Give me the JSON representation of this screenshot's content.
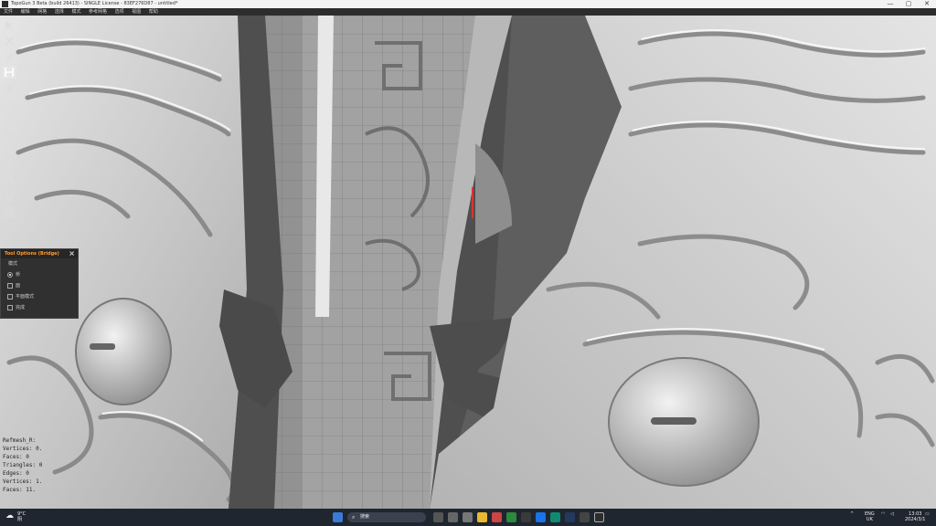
{
  "window": {
    "title": "TopoGun 3 Beta (build 26413) - SINGLE License - 83EF276D87 - untitled*",
    "minimize": "—",
    "maximize": "▢",
    "close": "✕"
  },
  "menu": [
    "文件",
    "编辑",
    "网格",
    "选择",
    "模式",
    "参考网格",
    "选项",
    "视图",
    "帮助"
  ],
  "toolbar": [
    {
      "icon": "select-icon",
      "active": false
    },
    {
      "icon": "erase-icon",
      "active": false
    },
    {
      "icon": "draw-icon",
      "active": false
    },
    {
      "icon": "bridge-icon",
      "active": true
    },
    {
      "icon": "move-icon",
      "active": false
    },
    {
      "icon": "slice-icon",
      "active": false
    },
    {
      "icon": "brush-icon",
      "active": false
    },
    {
      "icon": "tubes-icon",
      "active": false
    },
    {
      "icon": "extrude-icon",
      "active": false
    },
    {
      "icon": "knife-icon",
      "active": false
    },
    {
      "icon": "circle-icon",
      "active": false
    },
    {
      "icon": "magnet-icon",
      "active": false
    },
    {
      "icon": "grid-icon",
      "active": false
    }
  ],
  "tool_options": {
    "title": "Tool Options (Bridge)",
    "section_label": "模式",
    "options": [
      {
        "label": "桥",
        "type": "radio",
        "checked": true
      },
      {
        "label": "面",
        "type": "checkbox",
        "checked": false
      },
      {
        "label": "平面模式",
        "type": "checkbox",
        "checked": false
      },
      {
        "label": "完成",
        "type": "checkbox",
        "checked": false
      }
    ]
  },
  "stats": [
    "Refmesh_R:",
    "Vertices: 0.",
    "Faces: 0",
    "Triangles: 0",
    "Edges: 0",
    "Vertices: 1.",
    "Faces: 11."
  ],
  "taskbar": {
    "weather_temp": "9°C",
    "weather_desc": "阴",
    "search_placeholder": "搜索",
    "lang_top": "ENG",
    "lang_bottom": "UK",
    "time": "13:03",
    "date": "2024/3/1"
  },
  "colors": {
    "accent": "#ff9b2e",
    "mesh_surface": "#d8d8d8",
    "retopo_mesh": "#9a9a9a",
    "highlight_edge": "#e03030"
  }
}
